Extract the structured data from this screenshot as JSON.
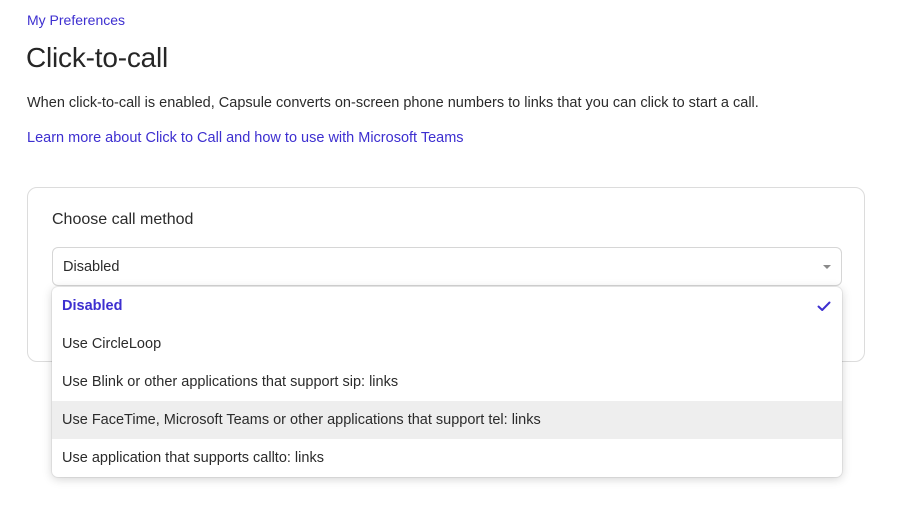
{
  "breadcrumb": {
    "label": "My Preferences"
  },
  "page": {
    "title": "Click-to-call",
    "description": "When click-to-call is enabled, Capsule converts on-screen phone numbers to links that you can click to start a call.",
    "learn_more_link": "Learn more about Click to Call and how to use with Microsoft Teams"
  },
  "card": {
    "heading": "Choose call method",
    "select": {
      "value": "Disabled",
      "options": [
        {
          "label": "Disabled",
          "selected": true
        },
        {
          "label": "Use CircleLoop",
          "selected": false
        },
        {
          "label": "Use Blink or other applications that support sip: links",
          "selected": false
        },
        {
          "label": "Use FaceTime, Microsoft Teams or other applications that support tel: links",
          "selected": false,
          "hovered": true
        },
        {
          "label": "Use application that supports callto: links",
          "selected": false
        }
      ]
    }
  },
  "colors": {
    "accent": "#3d2fd0",
    "hover": "#eeeeee",
    "border": "#dcdcdc"
  },
  "icons": {
    "select_caret": "caret-down-icon",
    "selected_check": "check-icon"
  }
}
